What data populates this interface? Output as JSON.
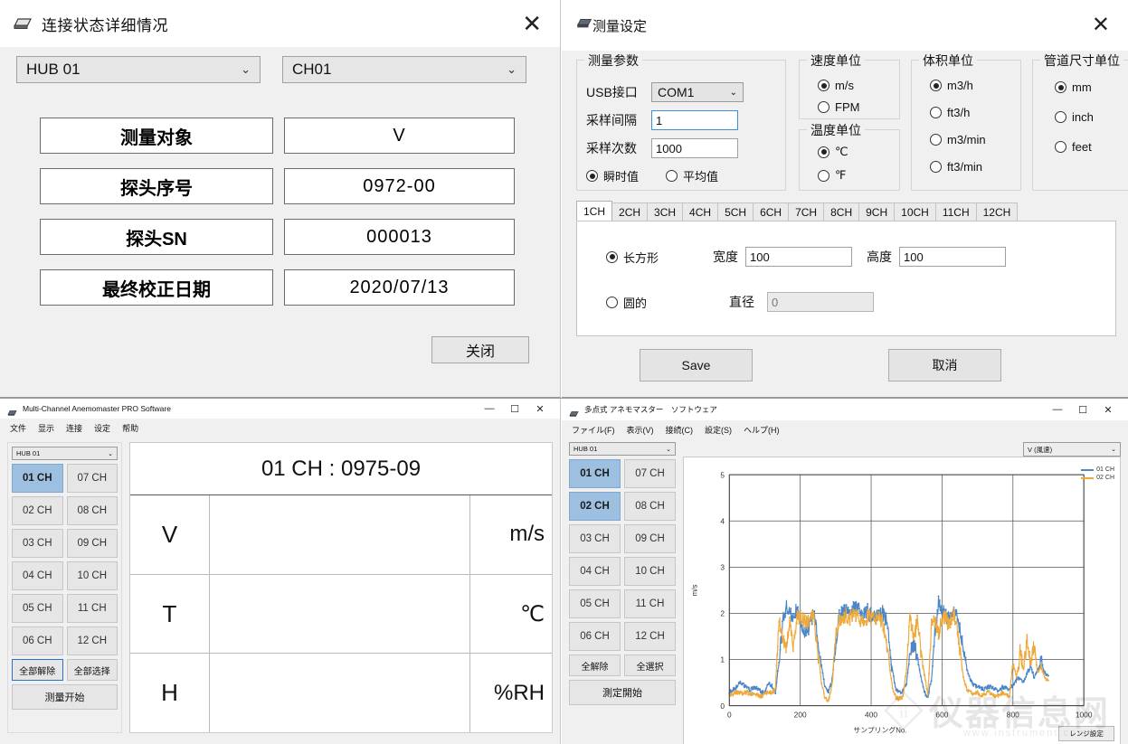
{
  "top_left": {
    "title": "连接状态详细情况",
    "close_glyph": "✕",
    "hub_select": "HUB 01",
    "ch_select": "CH01",
    "rows": [
      {
        "label": "测量对象",
        "value": "V"
      },
      {
        "label": "探头序号",
        "value": "0972-00"
      },
      {
        "label": "探头SN",
        "value": "000013"
      },
      {
        "label": "最终校正日期",
        "value": "2020/07/13"
      }
    ],
    "close_button": "关闭"
  },
  "top_right": {
    "title": "测量设定",
    "close_glyph": "✕",
    "params_group": {
      "legend": "测量参数",
      "usb_label": "USB接口",
      "usb_value": "COM1",
      "interval_label": "采样间隔",
      "interval_value": "1",
      "count_label": "采样次数",
      "count_value": "1000",
      "instant_label": "瞬时值",
      "average_label": "平均值",
      "mode_selected": "瞬时值"
    },
    "speed_group": {
      "legend": "速度单位",
      "options": [
        "m/s",
        "FPM"
      ],
      "selected": "m/s"
    },
    "temp_group": {
      "legend": "温度单位",
      "options": [
        "℃",
        "℉"
      ],
      "selected": "℃"
    },
    "volume_group": {
      "legend": "体积单位",
      "options": [
        "m3/h",
        "ft3/h",
        "m3/min",
        "ft3/min"
      ],
      "selected": "m3/h"
    },
    "duct_group": {
      "legend": "管道尺寸单位",
      "options": [
        "mm",
        "inch",
        "feet"
      ],
      "selected": "mm"
    },
    "tabs": [
      "1CH",
      "2CH",
      "3CH",
      "4CH",
      "5CH",
      "6CH",
      "7CH",
      "8CH",
      "9CH",
      "10CH",
      "11CH",
      "12CH"
    ],
    "active_tab": "1CH",
    "shape": {
      "rect_label": "长方形",
      "width_label": "宽度",
      "width_value": "100",
      "height_label": "高度",
      "height_value": "100",
      "circle_label": "圆的",
      "diameter_label": "直径",
      "diameter_value": "0",
      "selected": "长方形"
    },
    "save_button": "Save",
    "cancel_button": "取消"
  },
  "bottom_left": {
    "window_title": "Multi-Channel Anemomaster PRO Software",
    "minimize_glyph": "—",
    "maximize_glyph": "☐",
    "close_glyph": "✕",
    "menu": [
      "文件",
      "显示",
      "连接",
      "设定",
      "帮助"
    ],
    "hub_select": "HUB 01",
    "channels_col1": [
      "01 CH",
      "02 CH",
      "03 CH",
      "04 CH",
      "05 CH",
      "06 CH"
    ],
    "channels_col2": [
      "07 CH",
      "08 CH",
      "09 CH",
      "10 CH",
      "11 CH",
      "12 CH"
    ],
    "selected_channels": [
      "01 CH"
    ],
    "deselect_all": "全部解除",
    "select_all": "全部选择",
    "start_button": "测量开始",
    "panel_header": "01 CH : 0975-09",
    "readings": [
      {
        "symbol": "V",
        "value": "",
        "unit": "m/s"
      },
      {
        "symbol": "T",
        "value": "",
        "unit": "℃"
      },
      {
        "symbol": "H",
        "value": "",
        "unit": "%RH"
      }
    ]
  },
  "bottom_right": {
    "window_title": "多点式 アネモマスター　ソフトウェア",
    "minimize_glyph": "—",
    "maximize_glyph": "☐",
    "close_glyph": "✕",
    "menu": [
      "ファイル(F)",
      "表示(V)",
      "接続(C)",
      "設定(S)",
      "ヘルプ(H)"
    ],
    "hub_select": "HUB 01",
    "value_select": "V (風速)",
    "channels_col1": [
      "01 CH",
      "02 CH",
      "03 CH",
      "04 CH",
      "05 CH",
      "06 CH"
    ],
    "channels_col2": [
      "07 CH",
      "08 CH",
      "09 CH",
      "10 CH",
      "11 CH",
      "12 CH"
    ],
    "selected_channels": [
      "01 CH",
      "02 CH"
    ],
    "deselect_all": "全解除",
    "select_all": "全選択",
    "start_button": "測定開始",
    "range_button": "レンジ設定"
  },
  "watermark": {
    "text": "仪器信息网",
    "sub": "www.instrument.com.cn"
  },
  "colors": {
    "series1": "#4a86c8",
    "series2": "#eda93b",
    "selected_channel_bg": "#9dbfe0",
    "window_bg": "#f0f0f0"
  },
  "chart_data": {
    "type": "line",
    "title": "",
    "xlabel": "サンプリングNo.",
    "ylabel": "m/s",
    "xlim": [
      0,
      1000
    ],
    "ylim": [
      0,
      5
    ],
    "xticks": [
      0,
      200,
      400,
      600,
      800,
      1000
    ],
    "yticks": [
      0,
      1,
      2,
      3,
      4,
      5
    ],
    "grid": true,
    "legend_position": "right",
    "series": [
      {
        "name": "01 CH",
        "color": "#4a86c8",
        "x": [
          0,
          10,
          20,
          30,
          40,
          50,
          60,
          70,
          80,
          90,
          100,
          110,
          120,
          130,
          140,
          150,
          160,
          170,
          180,
          190,
          200,
          210,
          220,
          230,
          240,
          250,
          260,
          270,
          280,
          290,
          300,
          310,
          320,
          330,
          340,
          350,
          360,
          370,
          380,
          390,
          400,
          410,
          420,
          430,
          440,
          450,
          460,
          470,
          480,
          490,
          500,
          510,
          520,
          530,
          540,
          550,
          560,
          570,
          580,
          590,
          600,
          610,
          620,
          630,
          640,
          650,
          660,
          670,
          680,
          690,
          700,
          710,
          720,
          730,
          740,
          750,
          760,
          770,
          780,
          790,
          800,
          810,
          820,
          830,
          840,
          850,
          860,
          870,
          880,
          890,
          900
        ],
        "values": [
          0.3,
          0.35,
          0.4,
          0.52,
          0.45,
          0.38,
          0.34,
          0.4,
          0.36,
          0.3,
          0.28,
          0.5,
          0.42,
          0.3,
          0.95,
          1.8,
          2.15,
          2.0,
          1.95,
          2.05,
          1.9,
          1.55,
          1.6,
          1.9,
          2.0,
          1.35,
          0.85,
          0.4,
          0.3,
          0.55,
          1.35,
          1.95,
          2.05,
          2.1,
          2.0,
          2.1,
          2.15,
          2.05,
          1.95,
          2.05,
          1.95,
          1.9,
          2.0,
          2.05,
          1.9,
          1.45,
          0.75,
          0.35,
          0.3,
          0.32,
          0.5,
          1.2,
          1.35,
          1.05,
          0.6,
          0.3,
          0.18,
          0.55,
          1.55,
          2.2,
          2.05,
          1.95,
          1.85,
          2.0,
          2.05,
          1.65,
          1.2,
          0.8,
          0.55,
          0.45,
          0.4,
          0.38,
          0.35,
          0.42,
          0.4,
          0.36,
          0.32,
          0.4,
          0.38,
          0.35,
          0.45,
          0.55,
          0.62,
          0.5,
          0.7,
          0.85,
          0.6,
          0.75,
          0.95,
          0.7,
          0.65
        ]
      },
      {
        "name": "02 CH",
        "color": "#eda93b",
        "x": [
          0,
          10,
          20,
          30,
          40,
          50,
          60,
          70,
          80,
          90,
          100,
          110,
          120,
          130,
          140,
          150,
          160,
          170,
          180,
          190,
          200,
          210,
          220,
          230,
          240,
          250,
          260,
          270,
          280,
          290,
          300,
          310,
          320,
          330,
          340,
          350,
          360,
          370,
          380,
          390,
          400,
          410,
          420,
          430,
          440,
          450,
          460,
          470,
          480,
          490,
          500,
          510,
          520,
          530,
          540,
          550,
          560,
          570,
          580,
          590,
          600,
          610,
          620,
          630,
          640,
          650,
          660,
          670,
          680,
          690,
          700,
          710,
          720,
          730,
          740,
          750,
          760,
          770,
          780,
          790,
          800,
          810,
          820,
          830,
          840,
          850,
          860,
          870,
          880,
          890,
          900
        ],
        "values": [
          0.22,
          0.25,
          0.3,
          0.28,
          0.26,
          0.3,
          0.24,
          0.28,
          0.22,
          0.2,
          0.25,
          0.3,
          0.28,
          0.35,
          1.9,
          1.45,
          1.3,
          1.85,
          1.25,
          1.9,
          1.95,
          1.85,
          1.8,
          1.95,
          1.85,
          1.1,
          0.5,
          0.15,
          0.12,
          0.45,
          1.55,
          1.8,
          1.9,
          1.95,
          1.9,
          2.0,
          1.95,
          1.85,
          1.75,
          1.95,
          1.9,
          1.8,
          1.95,
          1.85,
          1.55,
          0.95,
          0.4,
          0.18,
          0.15,
          0.2,
          0.8,
          1.95,
          1.4,
          1.85,
          1.2,
          0.7,
          0.25,
          1.7,
          1.85,
          1.5,
          1.9,
          1.95,
          1.7,
          2.0,
          1.85,
          1.25,
          0.6,
          0.35,
          0.3,
          0.25,
          0.28,
          0.22,
          0.26,
          0.3,
          0.24,
          0.2,
          0.22,
          0.28,
          0.25,
          0.2,
          0.95,
          0.6,
          1.15,
          0.8,
          1.4,
          0.95,
          1.3,
          0.7,
          0.85,
          0.6,
          0.55
        ]
      }
    ]
  }
}
